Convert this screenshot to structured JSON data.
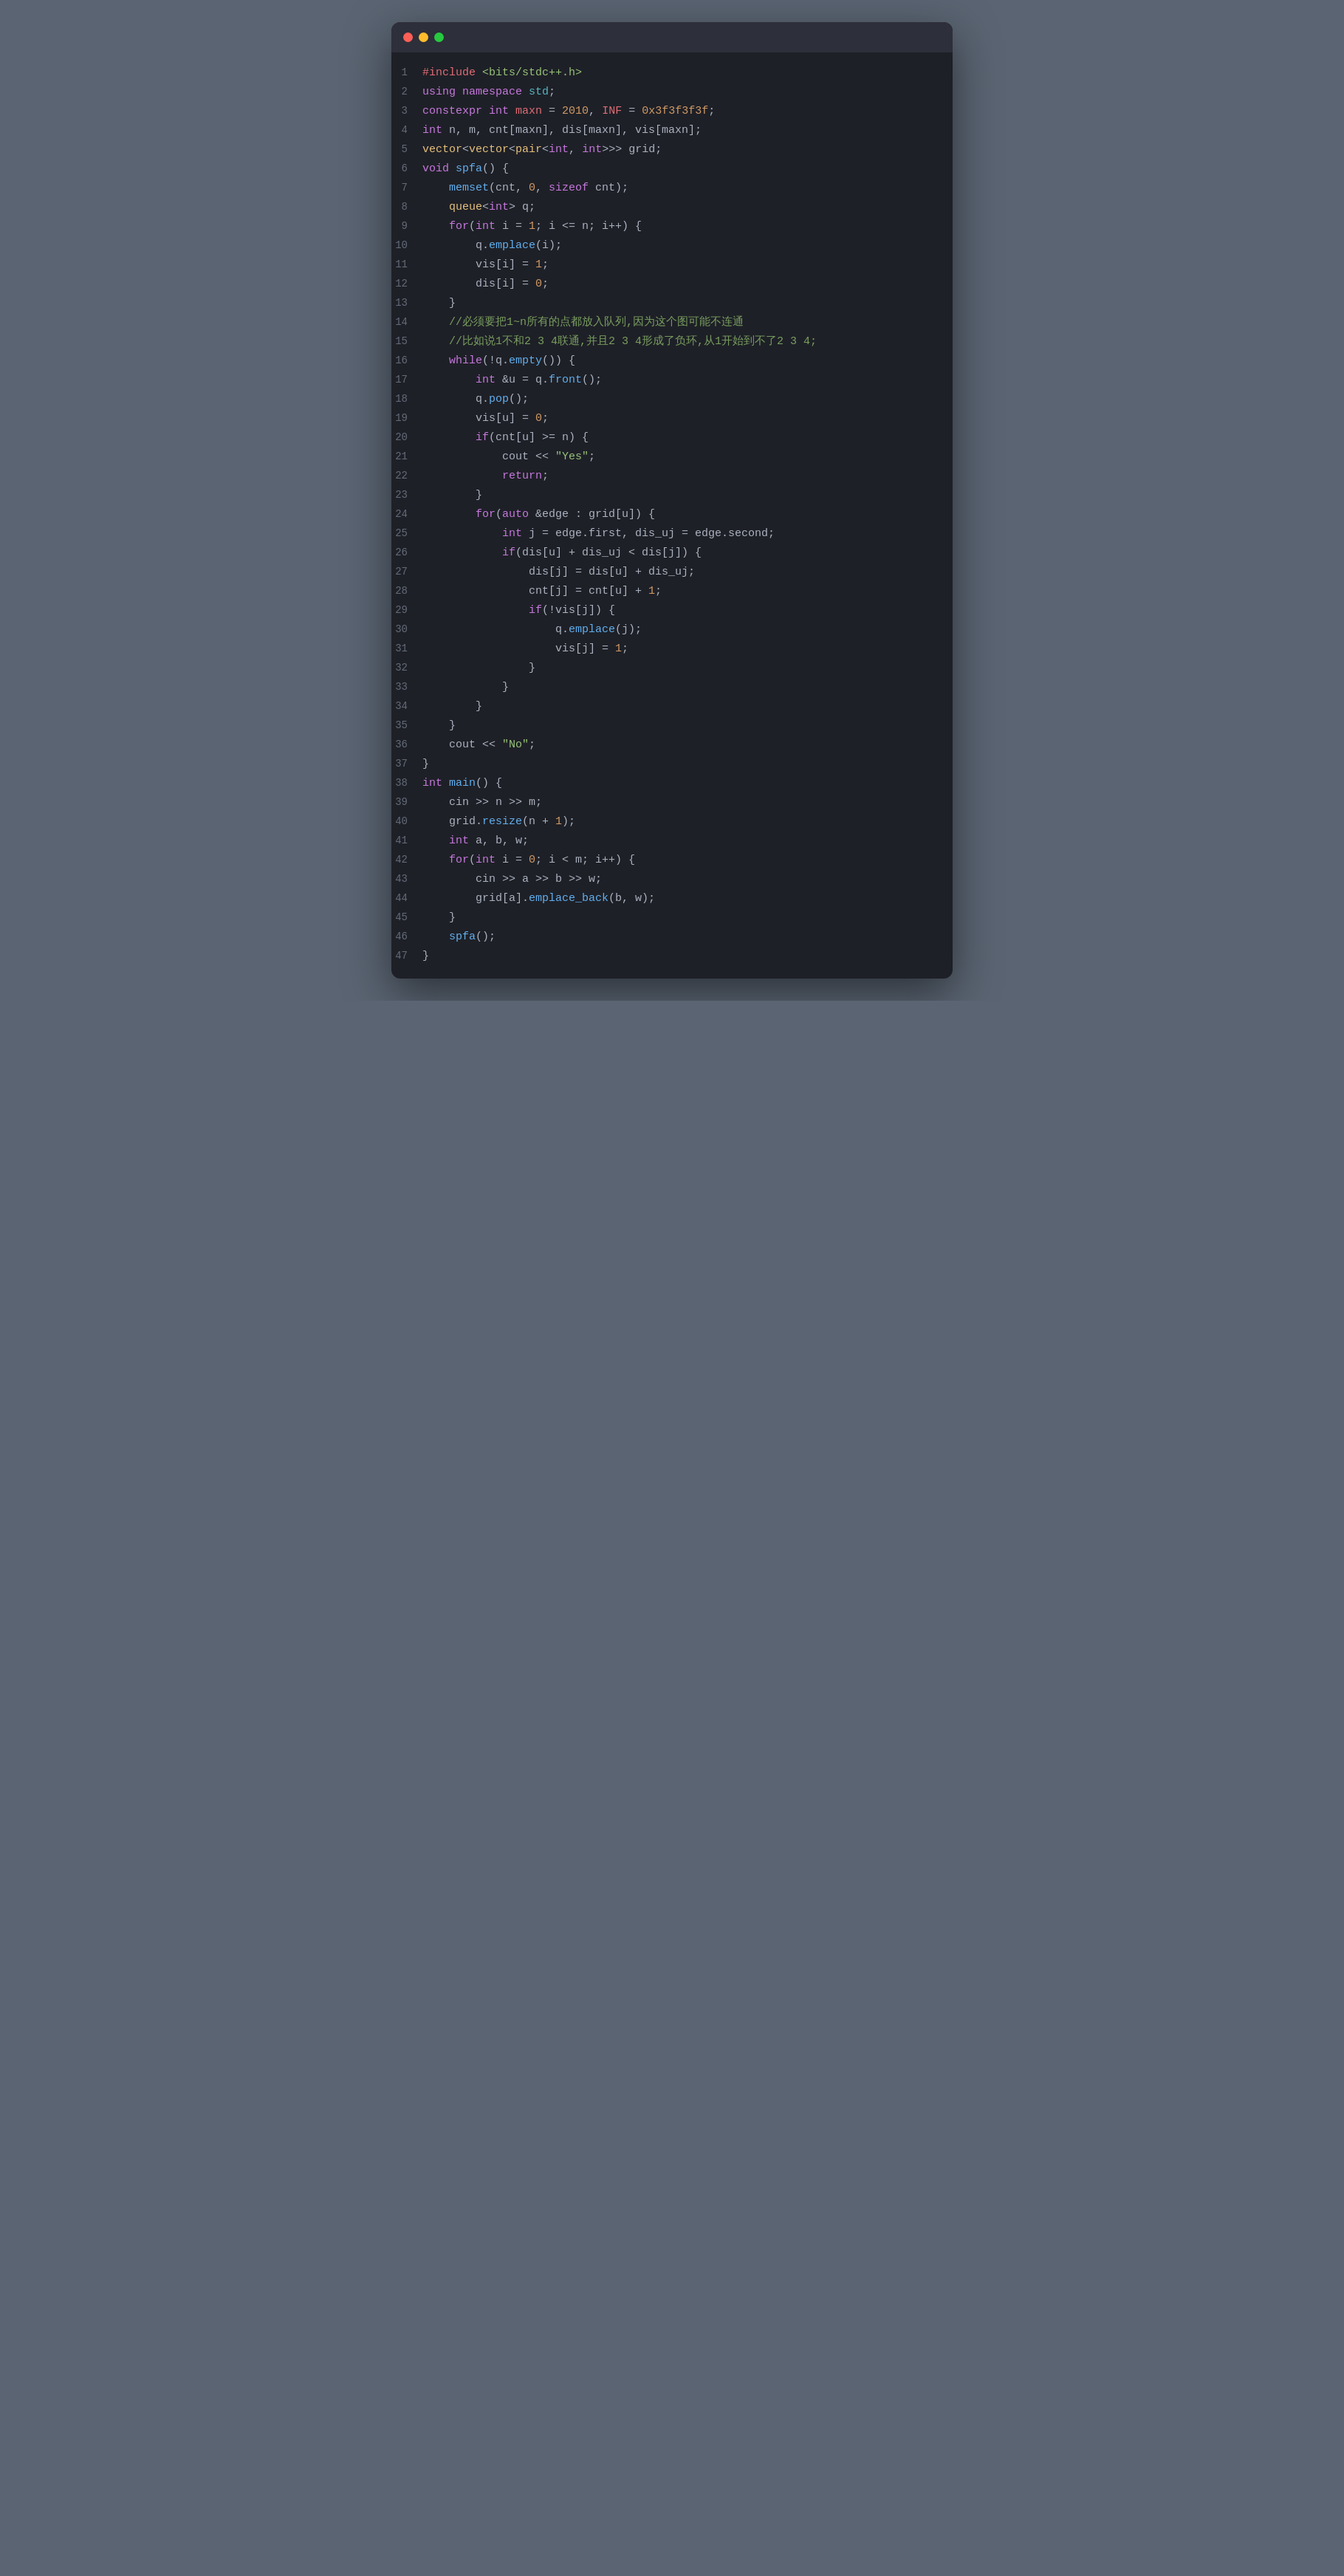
{
  "window": {
    "titlebar": {
      "dot_red": "close",
      "dot_yellow": "minimize",
      "dot_green": "maximize"
    }
  },
  "code": {
    "lines": [
      {
        "num": 1,
        "content": "#include <bits/stdc++.h>"
      },
      {
        "num": 2,
        "content": "using namespace std;"
      },
      {
        "num": 3,
        "content": "constexpr int maxn = 2010, INF = 0x3f3f3f3f;"
      },
      {
        "num": 4,
        "content": "int n, m, cnt[maxn], dis[maxn], vis[maxn];"
      },
      {
        "num": 5,
        "content": "vector<vector<pair<int, int>>> grid;"
      },
      {
        "num": 6,
        "content": "void spfa() {"
      },
      {
        "num": 7,
        "content": "    memset(cnt, 0, sizeof cnt);"
      },
      {
        "num": 8,
        "content": "    queue<int> q;"
      },
      {
        "num": 9,
        "content": "    for(int i = 1; i <= n; i++) {"
      },
      {
        "num": 10,
        "content": "        q.emplace(i);"
      },
      {
        "num": 11,
        "content": "        vis[i] = 1;"
      },
      {
        "num": 12,
        "content": "        dis[i] = 0;"
      },
      {
        "num": 13,
        "content": "    }"
      },
      {
        "num": 14,
        "content": "    //必须要把1~n所有的点都放入队列,因为这个图可能不连通"
      },
      {
        "num": 15,
        "content": "    //比如说1不和2 3 4联通,并且2 3 4形成了负环,从1开始到不了2 3 4;"
      },
      {
        "num": 16,
        "content": "    while(!q.empty()) {"
      },
      {
        "num": 17,
        "content": "        int &u = q.front();"
      },
      {
        "num": 18,
        "content": "        q.pop();"
      },
      {
        "num": 19,
        "content": "        vis[u] = 0;"
      },
      {
        "num": 20,
        "content": "        if(cnt[u] >= n) {"
      },
      {
        "num": 21,
        "content": "            cout << \"Yes\";"
      },
      {
        "num": 22,
        "content": "            return;"
      },
      {
        "num": 23,
        "content": "        }"
      },
      {
        "num": 24,
        "content": "        for(auto &edge : grid[u]) {"
      },
      {
        "num": 25,
        "content": "            int j = edge.first, dis_uj = edge.second;"
      },
      {
        "num": 26,
        "content": "            if(dis[u] + dis_uj < dis[j]) {"
      },
      {
        "num": 27,
        "content": "                dis[j] = dis[u] + dis_uj;"
      },
      {
        "num": 28,
        "content": "                cnt[j] = cnt[u] + 1;"
      },
      {
        "num": 29,
        "content": "                if(!vis[j]) {"
      },
      {
        "num": 30,
        "content": "                    q.emplace(j);"
      },
      {
        "num": 31,
        "content": "                    vis[j] = 1;"
      },
      {
        "num": 32,
        "content": "                }"
      },
      {
        "num": 33,
        "content": "            }"
      },
      {
        "num": 34,
        "content": "        }"
      },
      {
        "num": 35,
        "content": "    }"
      },
      {
        "num": 36,
        "content": "    cout << \"No\";"
      },
      {
        "num": 37,
        "content": "}"
      },
      {
        "num": 38,
        "content": "int main() {"
      },
      {
        "num": 39,
        "content": "    cin >> n >> m;"
      },
      {
        "num": 40,
        "content": "    grid.resize(n + 1);"
      },
      {
        "num": 41,
        "content": "    int a, b, w;"
      },
      {
        "num": 42,
        "content": "    for(int i = 0; i < m; i++) {"
      },
      {
        "num": 43,
        "content": "        cin >> a >> b >> w;"
      },
      {
        "num": 44,
        "content": "        grid[a].emplace_back(b, w);"
      },
      {
        "num": 45,
        "content": "    }"
      },
      {
        "num": 46,
        "content": "    spfa();"
      },
      {
        "num": 47,
        "content": "}"
      }
    ]
  }
}
